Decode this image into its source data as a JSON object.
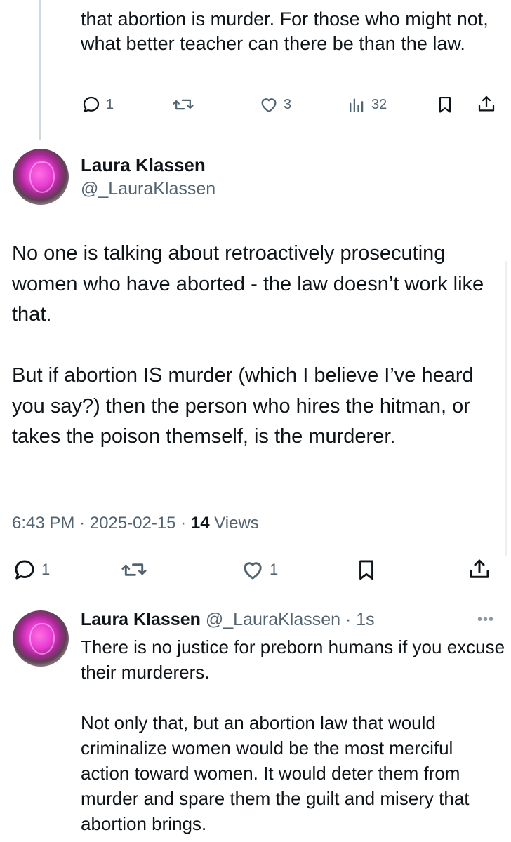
{
  "parent_reply": {
    "text": "that abortion is murder. For those who might not, what better teacher can there be than the law.",
    "stats": {
      "replies": "1",
      "likes": "3",
      "views": "32"
    }
  },
  "main_tweet": {
    "name": "Laura Klassen",
    "handle": "@_LauraKlassen",
    "text": "No one is talking about retroactively prosecuting women who have aborted - the law doesn’t work like that.\n\nBut if abortion IS murder (which I believe I’ve heard you say?) then the person who hires the hitman, or takes the poison themself, is the murderer.",
    "time": "6:43 PM",
    "date": "2025-02-15",
    "views_count": "14",
    "views_label": "Views",
    "stats": {
      "replies": "1",
      "likes": "1"
    }
  },
  "reply_tweet": {
    "name": "Laura Klassen",
    "handle": "@_LauraKlassen",
    "age": "1s",
    "text": "There is no justice for preborn humans if you excuse their murderers.\n\nNot only that, but an abortion law that would criminalize women would be the most merciful action toward women. It would deter them from murder and spare them the guilt and misery that abortion brings."
  },
  "icons": {
    "reply": "reply-icon",
    "repost": "repost-icon",
    "like": "heart-icon",
    "views": "views-icon",
    "bookmark": "bookmark-icon",
    "share": "share-icon",
    "more": "more-icon"
  },
  "colors": {
    "text": "#0f1419",
    "muted": "#536471",
    "avatar_accent": "#e63bd0"
  }
}
